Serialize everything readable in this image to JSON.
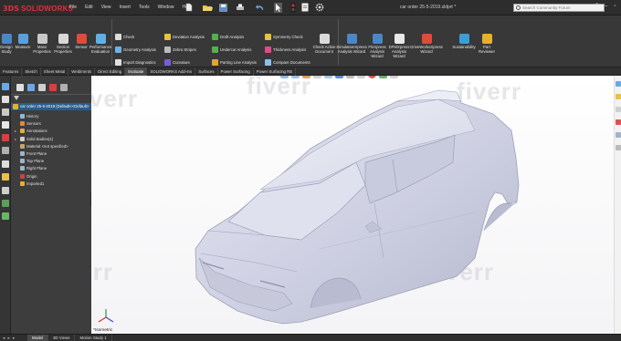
{
  "app": {
    "logo_prefix": "3DS",
    "logo_text": "SOLIDWORKS",
    "brand_color": "#e0303a"
  },
  "menus": [
    "File",
    "Edit",
    "View",
    "Insert",
    "Tools",
    "Window",
    "Help"
  ],
  "document_title": "car order 25-5-2019.sldprt *",
  "search": {
    "placeholder": "Search Community Forum"
  },
  "ribbon": {
    "left_tools": [
      {
        "label": "Design Study",
        "icon": "design-study-icon",
        "color": "#4a87c9"
      },
      {
        "label": "Measure",
        "icon": "measure-icon",
        "color": "#5aa0e0"
      },
      {
        "label": "Mass Properties",
        "icon": "mass-properties-icon",
        "color": "#c9c9c9"
      },
      {
        "label": "Section Properties",
        "icon": "section-properties-icon",
        "color": "#d8d8d8"
      },
      {
        "label": "Sensor",
        "icon": "sensor-icon",
        "color": "#e04b3a"
      },
      {
        "label": "Performance Evaluation",
        "icon": "performance-evaluation-icon",
        "color": "#60b0e8"
      }
    ],
    "check_group": [
      {
        "label": "Check",
        "icon": "check-icon",
        "color": "#dcdcdc"
      },
      {
        "label": "Geometry Analysis",
        "icon": "geometry-analysis-icon",
        "color": "#6fb3e6"
      },
      {
        "label": "Import Diagnostics",
        "icon": "import-diagnostics-icon",
        "color": "#e0e0e0"
      }
    ],
    "analysis_group": [
      {
        "label": "Deviation Analysis",
        "icon": "deviation-analysis-icon",
        "color": "#e8c33a"
      },
      {
        "label": "Zebra Stripes",
        "icon": "zebra-stripes-icon",
        "color": "#bbbbbb"
      },
      {
        "label": "Curvature",
        "icon": "curvature-icon",
        "color": "#7a5cd6"
      }
    ],
    "draft_group": [
      {
        "label": "Draft Analysis",
        "icon": "draft-analysis-icon",
        "color": "#4fb34a"
      },
      {
        "label": "Undercut Analysis",
        "icon": "undercut-analysis-icon",
        "color": "#55b050"
      },
      {
        "label": "Parting Line Analysis",
        "icon": "parting-line-analysis-icon",
        "color": "#e0a23a"
      }
    ],
    "symmetry_group": [
      {
        "label": "Symmetry Check",
        "icon": "symmetry-check-icon",
        "color": "#e8c33a"
      },
      {
        "label": "Thickness Analysis",
        "icon": "thickness-analysis-icon",
        "color": "#e04b8a"
      },
      {
        "label": "Compare Documents",
        "icon": "compare-documents-icon",
        "color": "#8fc0ea"
      }
    ],
    "check_active": {
      "label": "Check Active Document",
      "icon": "check-active-document-icon",
      "color": "#dadada"
    },
    "right_tools": [
      {
        "label": "SimulationXpress Analysis Wizard",
        "icon": "simulationxpress-icon",
        "color": "#4a87c9"
      },
      {
        "label": "FloXpress Analysis Wizard",
        "icon": "floxpress-icon",
        "color": "#4a87c9"
      },
      {
        "label": "DFMXpress Analysis Wizard",
        "icon": "dfmxpress-icon",
        "color": "#e8e8e8"
      },
      {
        "label": "DriveWorksXpress Wizard",
        "icon": "driveworksxpress-icon",
        "color": "#e04b3a"
      },
      {
        "label": "Sustainability",
        "icon": "sustainability-icon",
        "color": "#3a9ed8"
      },
      {
        "label": "Part Reviewer",
        "icon": "part-reviewer-icon",
        "color": "#e8b02a"
      }
    ]
  },
  "tabs": [
    {
      "label": "Features",
      "active": false
    },
    {
      "label": "Sketch",
      "active": false
    },
    {
      "label": "Sheet Metal",
      "active": false
    },
    {
      "label": "Weldments",
      "active": false
    },
    {
      "label": "Direct Editing",
      "active": false
    },
    {
      "label": "Evaluate",
      "active": true
    },
    {
      "label": "SOLIDWORKS Add-Ins",
      "active": false
    },
    {
      "label": "Surfaces",
      "active": false
    },
    {
      "label": "Power Surfacing",
      "active": false
    },
    {
      "label": "Power Surfacing RE",
      "active": false
    }
  ],
  "tree": {
    "root": "car order 25-5-2019 (Default<<Default>",
    "items": [
      {
        "label": "History",
        "icon": "history-icon",
        "color": "#8fb8e0",
        "expand": ""
      },
      {
        "label": "Sensors",
        "icon": "sensors-icon",
        "color": "#e08a3a",
        "expand": ""
      },
      {
        "label": "Annotations",
        "icon": "annotations-icon",
        "color": "#e0b03a",
        "expand": "▸"
      },
      {
        "label": "Solid Bodies(1)",
        "icon": "solid-bodies-icon",
        "color": "#cfcfcf",
        "expand": "▸"
      },
      {
        "label": "Material <not specified>",
        "icon": "material-icon",
        "color": "#c9a36a",
        "expand": ""
      },
      {
        "label": "Front Plane",
        "icon": "plane-icon",
        "color": "#9fb4cc",
        "expand": ""
      },
      {
        "label": "Top Plane",
        "icon": "plane-icon",
        "color": "#9fb4cc",
        "expand": ""
      },
      {
        "label": "Right Plane",
        "icon": "plane-icon",
        "color": "#9fb4cc",
        "expand": ""
      },
      {
        "label": "Origin",
        "icon": "origin-icon",
        "color": "#d04040",
        "expand": ""
      },
      {
        "label": "Imported1",
        "icon": "imported-icon",
        "color": "#e8b02a",
        "expand": ""
      }
    ]
  },
  "viewport": {
    "view_label": "*Isometric",
    "watermark": "fiverr",
    "model_color": "#d2d4e6"
  },
  "bottom_tabs": [
    {
      "label": "Model",
      "active": true
    },
    {
      "label": "3D Views",
      "active": false
    },
    {
      "label": "Motion Study 1",
      "active": false
    }
  ],
  "bottom_nav": "◂ ▸ ▸"
}
